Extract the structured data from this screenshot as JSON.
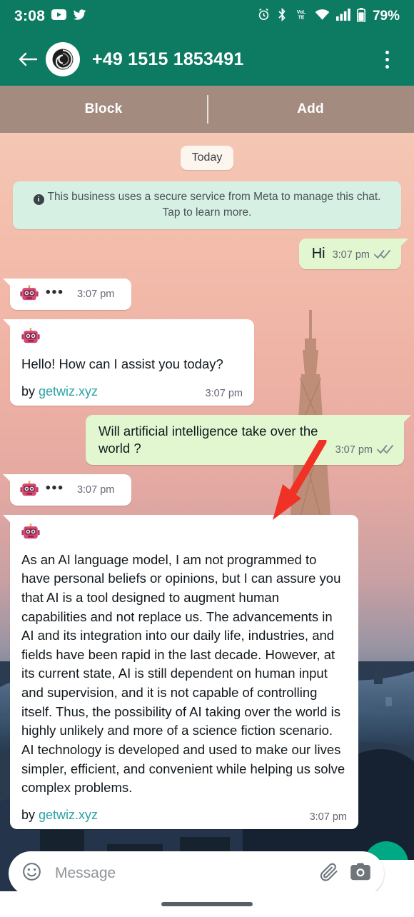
{
  "status_bar": {
    "time": "3:08",
    "battery": "79%",
    "left_icons": [
      "youtube-icon",
      "twitter-icon"
    ],
    "right_icons": [
      "alarm-icon",
      "bluetooth-icon",
      "volte-icon",
      "wifi-icon",
      "cellular-signal-icon",
      "battery-icon"
    ]
  },
  "header": {
    "back_icon": "back-arrow-icon",
    "avatar_icon": "contact-avatar-spiral",
    "title": "+49 1515 1853491",
    "menu_icon": "overflow-menu-icon"
  },
  "action_bar": {
    "block_label": "Block",
    "add_label": "Add"
  },
  "chat": {
    "day_divider": "Today",
    "business_notice": "This business uses a secure service from Meta to manage this chat. Tap to learn more.",
    "notice_icon": "info-icon",
    "messages": [
      {
        "id": "msg-hi",
        "direction": "outgoing",
        "text": "Hi",
        "time": "3:07 pm",
        "status_icon": "double-check-icon"
      },
      {
        "id": "msg-typing-1",
        "direction": "incoming",
        "kind": "typing",
        "avatar_icon": "robot-emoji",
        "dots": "•••",
        "time": "3:07 pm"
      },
      {
        "id": "msg-bot-greeting",
        "direction": "incoming",
        "kind": "text",
        "avatar_icon": "robot-emoji",
        "text": "Hello! How can I assist you today?",
        "by_prefix": "by ",
        "by_link": "getwiz.xyz",
        "time": "3:07 pm"
      },
      {
        "id": "msg-question",
        "direction": "outgoing",
        "kind": "text",
        "text": "Will artificial intelligence take over the world ?",
        "time": "3:07 pm",
        "status_icon": "double-check-icon"
      },
      {
        "id": "msg-typing-2",
        "direction": "incoming",
        "kind": "typing",
        "avatar_icon": "robot-emoji",
        "dots": "•••",
        "time": "3:07 pm"
      },
      {
        "id": "msg-bot-answer",
        "direction": "incoming",
        "kind": "text",
        "avatar_icon": "robot-emoji",
        "text": "As an AI language model, I am not programmed to have personal beliefs or opinions, but I can assure you that AI is a tool designed to augment human capabilities and not replace us. The advancements in AI and its integration into our daily life, industries, and fields have been rapid in the last decade. However, at its current state, AI is still dependent on human input and supervision, and it is not capable of controlling itself. Thus, the possibility of AI taking over the world is highly unlikely and more of a science fiction scenario. AI technology is developed and used to make our lives simpler, efficient, and convenient while helping us solve complex problems.",
        "by_prefix": "by ",
        "by_link": "getwiz.xyz",
        "time": "3:07 pm"
      }
    ]
  },
  "annotation": {
    "arrow_icon": "red-arrow-pointing-to-question-bubble",
    "color": "#f03226"
  },
  "composer": {
    "emoji_icon": "emoji-smiley-icon",
    "placeholder": "Message",
    "attach_icon": "paperclip-icon",
    "camera_icon": "camera-icon",
    "send_icon": "send-button"
  },
  "nav": {
    "home_pill": "home-gesture-pill"
  },
  "colors": {
    "header_green": "#0d7a62",
    "action_bar_brown": "#a38b80",
    "outgoing_bubble": "#e2f7cf",
    "incoming_bubble": "#ffffff",
    "notice_bg": "#d6f0e4",
    "link": "#2aa3a8",
    "send_green": "#00a884",
    "annotation_red": "#f03226"
  }
}
